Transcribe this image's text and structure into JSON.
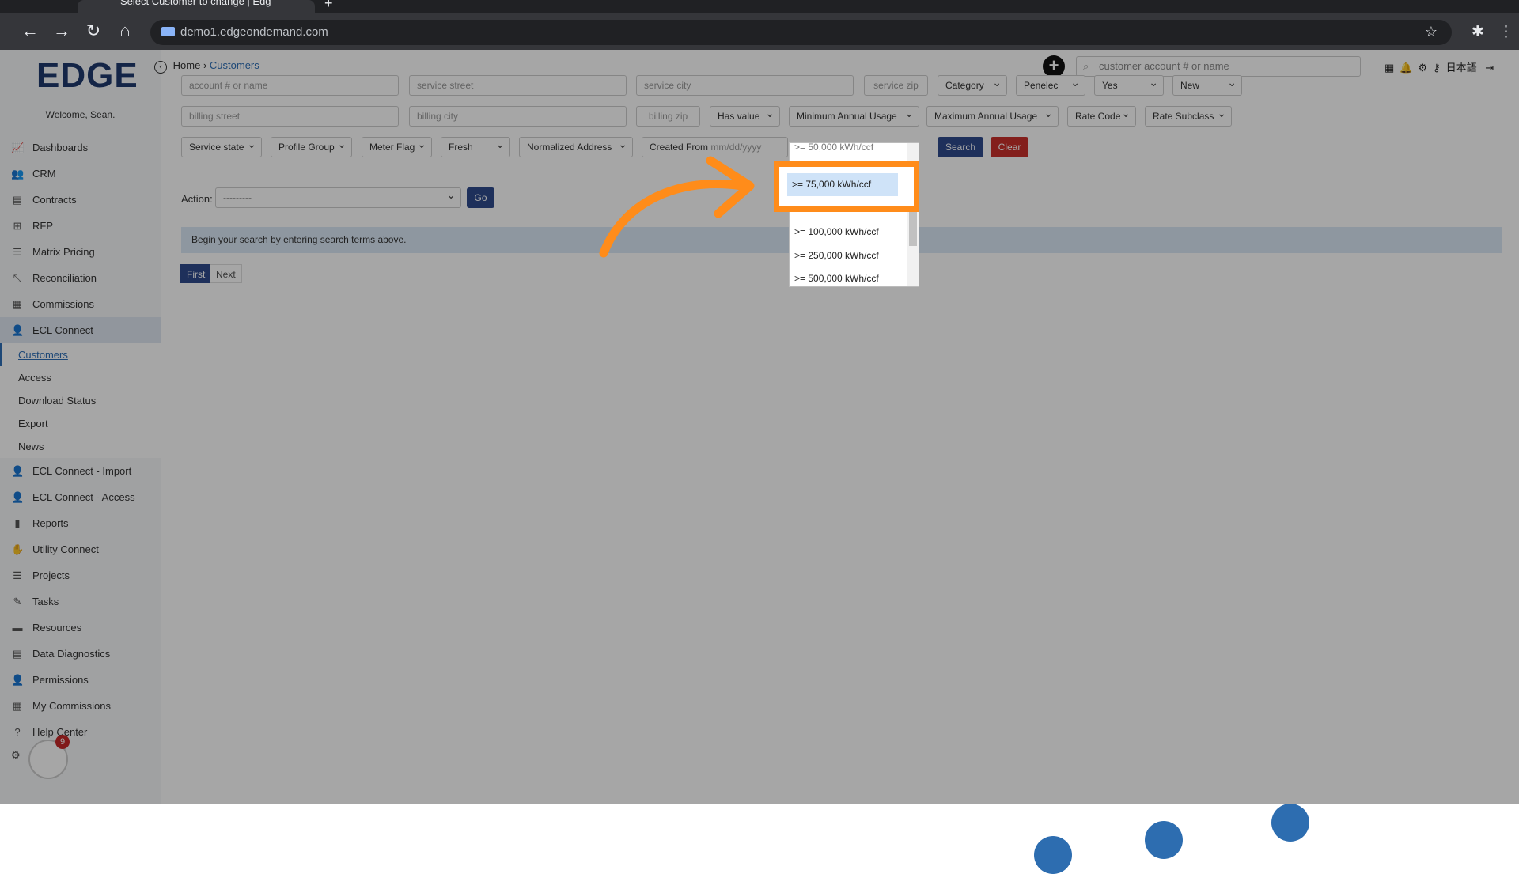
{
  "browser": {
    "tab_title": "Select Customer to change | Edg",
    "url": "demo1.edgeondemand.com"
  },
  "sidebar": {
    "logo": "EDGE",
    "welcome": "Welcome, Sean.",
    "items": [
      {
        "label": "Dashboards",
        "icon": "chart-icon"
      },
      {
        "label": "CRM",
        "icon": "users-icon"
      },
      {
        "label": "Contracts",
        "icon": "file-icon"
      },
      {
        "label": "RFP",
        "icon": "sitemap-icon"
      },
      {
        "label": "Matrix Pricing",
        "icon": "list-icon"
      },
      {
        "label": "Reconciliation",
        "icon": "compress-icon"
      },
      {
        "label": "Commissions",
        "icon": "money-icon"
      },
      {
        "label": "ECL Connect",
        "icon": "user-plug-icon"
      }
    ],
    "subitems": [
      {
        "label": "Customers"
      },
      {
        "label": "Access"
      },
      {
        "label": "Download Status"
      },
      {
        "label": "Export"
      },
      {
        "label": "News"
      }
    ],
    "items2": [
      {
        "label": "ECL Connect - Import",
        "icon": "user-plug-icon"
      },
      {
        "label": "ECL Connect - Access",
        "icon": "user-plug-icon"
      },
      {
        "label": "Reports",
        "icon": "bar-chart-icon"
      },
      {
        "label": "Utility Connect",
        "icon": "hand-icon"
      },
      {
        "label": "Projects",
        "icon": "list-icon"
      },
      {
        "label": "Tasks",
        "icon": "tasks-icon"
      },
      {
        "label": "Resources",
        "icon": "folder-icon"
      },
      {
        "label": "Data Diagnostics",
        "icon": "table-icon"
      },
      {
        "label": "Permissions",
        "icon": "user-icon"
      },
      {
        "label": "My Commissions",
        "icon": "money-icon"
      },
      {
        "label": "Help Center",
        "icon": "question-icon"
      }
    ],
    "badge_count": "9"
  },
  "header": {
    "breadcrumb_home": "Home",
    "breadcrumb_sep": "›",
    "breadcrumb_current": "Customers",
    "search_placeholder": "customer account # or name",
    "lang": "日本語"
  },
  "filters": {
    "row1": {
      "account_placeholder": "account # or name",
      "service_street_placeholder": "service street",
      "service_city_placeholder": "service city",
      "service_zip_placeholder": "service zip",
      "category": "Category",
      "utility": "Penelec",
      "yes": "Yes",
      "new": "New"
    },
    "row2": {
      "billing_street_placeholder": "billing street",
      "billing_city_placeholder": "billing city",
      "billing_zip_placeholder": "billing zip",
      "has_value": "Has value",
      "min_usage": "Minimum Annual Usage",
      "max_usage": "Maximum Annual Usage",
      "rate_code": "Rate Code",
      "rate_subclass": "Rate Subclass"
    },
    "row3": {
      "service_state": "Service state",
      "profile_group": "Profile Group",
      "meter_flag": "Meter Flag",
      "fresh": "Fresh",
      "normalized_address": "Normalized Address",
      "created_from": "Created From",
      "date_placeholder": "mm/dd/yyyy",
      "search": "Search",
      "clear": "Clear"
    }
  },
  "action": {
    "label": "Action:",
    "selected": "---------",
    "go": "Go"
  },
  "info_message": "Begin your search by entering search terms above.",
  "pagination": {
    "first": "First",
    "next": "Next"
  },
  "dropdown": {
    "partial_top": ">= 50,000 kWh/ccf",
    "highlighted": ">= 75,000 kWh/ccf",
    "options": [
      ">= 100,000 kWh/ccf",
      ">= 250,000 kWh/ccf",
      ">= 500,000 kWh/ccf"
    ]
  },
  "colors": {
    "accent_orange": "#ff8c1a",
    "primary_blue": "#2e4a8c",
    "danger_red": "#c9302c",
    "link_blue": "#2e6fb7"
  }
}
